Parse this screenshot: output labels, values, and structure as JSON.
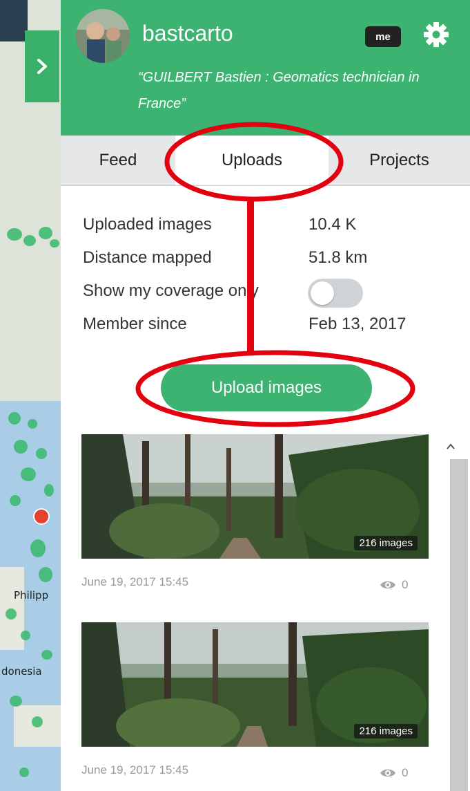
{
  "map": {
    "labels": [
      "Philipp",
      "donesia"
    ]
  },
  "profile": {
    "username": "bastcarto",
    "badge": "me",
    "bio": "“GUILBERT Bastien : Geomatics technician in France”"
  },
  "tabs": [
    {
      "label": "Feed",
      "active": false
    },
    {
      "label": "Uploads",
      "active": true
    },
    {
      "label": "Projects",
      "active": false
    }
  ],
  "stats": {
    "uploaded_images_label": "Uploaded images",
    "uploaded_images_value": "10.4 K",
    "distance_label": "Distance mapped",
    "distance_value": "51.8 km",
    "coverage_label": "Show my coverage only",
    "coverage_on": false,
    "member_label": "Member since",
    "member_value": "Feb 13, 2017"
  },
  "upload_button": "Upload images",
  "uploads": [
    {
      "count": "216 images",
      "date": "June 19, 2017 15:45",
      "views": "0"
    },
    {
      "count": "216 images",
      "date": "June 19, 2017 15:45",
      "views": "0"
    }
  ],
  "colors": {
    "brand_green": "#3cb371",
    "annotation_red": "#e3000f"
  },
  "icons": [
    "chevron-right-icon",
    "gear-icon",
    "eye-icon",
    "scroll-up-icon"
  ]
}
